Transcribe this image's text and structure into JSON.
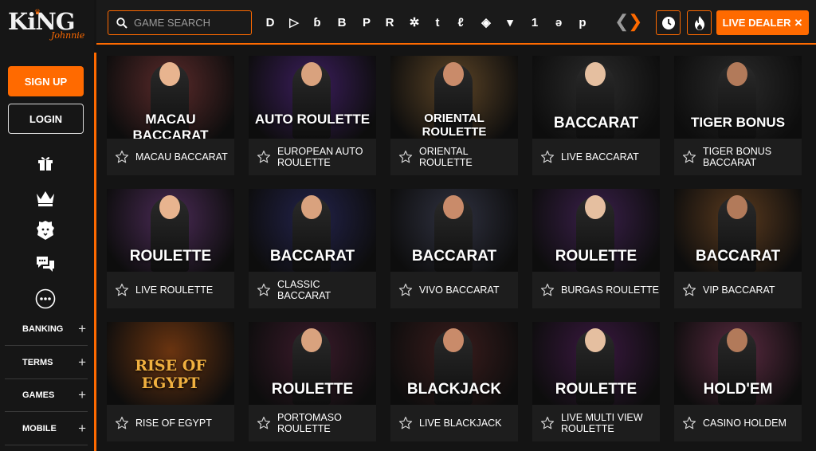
{
  "brand": {
    "name": "KiNG",
    "tagline": "Johnnie"
  },
  "sidebar": {
    "signup_label": "SIGN UP",
    "login_label": "LOGIN",
    "icons": [
      "gift-icon",
      "crown-icon",
      "lion-icon",
      "chat-icon",
      "more-icon"
    ],
    "menu": [
      {
        "label": "BANKING"
      },
      {
        "label": "TERMS"
      },
      {
        "label": "GAMES"
      },
      {
        "label": "MOBILE"
      }
    ]
  },
  "topbar": {
    "search_placeholder": "GAME SEARCH",
    "providers": [
      "D",
      "▷",
      "ɓ",
      "B",
      "P",
      "R",
      "✲",
      "t",
      "ℓ",
      "◈",
      "▾",
      "1",
      "ǝ",
      "p"
    ],
    "live_dealer_label": "LIVE DEALER",
    "accent": "#ff6a00"
  },
  "games": [
    {
      "title": "MACAU BACCARAT",
      "logo": "MACAU BACCARAT",
      "bg": "#5a2a2a"
    },
    {
      "title": "EUROPEAN AUTO ROULETTE",
      "logo": "AUTO ROULETTE",
      "bg": "#3b1d5c"
    },
    {
      "title": "ORIENTAL ROULETTE",
      "logo": "ORIENTAL ROULETTE",
      "bg": "#5c4426"
    },
    {
      "title": "LIVE BACCARAT",
      "logo": "BACCARAT",
      "bg": "#2b2b2b"
    },
    {
      "title": "TIGER BONUS BACCARAT",
      "logo": "TIGER BONUS",
      "bg": "#2a2a2a"
    },
    {
      "title": "LIVE ROULETTE",
      "logo": "ROULETTE",
      "bg": "#4a2a55"
    },
    {
      "title": "CLASSIC BACCARAT",
      "logo": "BACCARAT",
      "bg": "#22224a"
    },
    {
      "title": "VIVO BACCARAT",
      "logo": "BACCARAT",
      "bg": "#2f3140"
    },
    {
      "title": "BURGAS ROULETTE",
      "logo": "ROULETTE",
      "bg": "#3a1f4a"
    },
    {
      "title": "VIP BACCARAT",
      "logo": "BACCARAT",
      "bg": "#5a3a1e"
    },
    {
      "title": "RISE OF EGYPT",
      "logo": "RISE OF EGYPT",
      "bg": "#6a3410"
    },
    {
      "title": "PORTOMASO ROULETTE",
      "logo": "ROULETTE",
      "bg": "#3a1a2a"
    },
    {
      "title": "LIVE BLACKJACK",
      "logo": "BLACKJACK",
      "bg": "#3a1c1c"
    },
    {
      "title": "LIVE MULTI VIEW ROULETTE",
      "logo": "ROULETTE",
      "bg": "#3a1840"
    },
    {
      "title": "CASINO HOLDEM",
      "logo": "HOLD'EM",
      "bg": "#5a2a40"
    }
  ]
}
